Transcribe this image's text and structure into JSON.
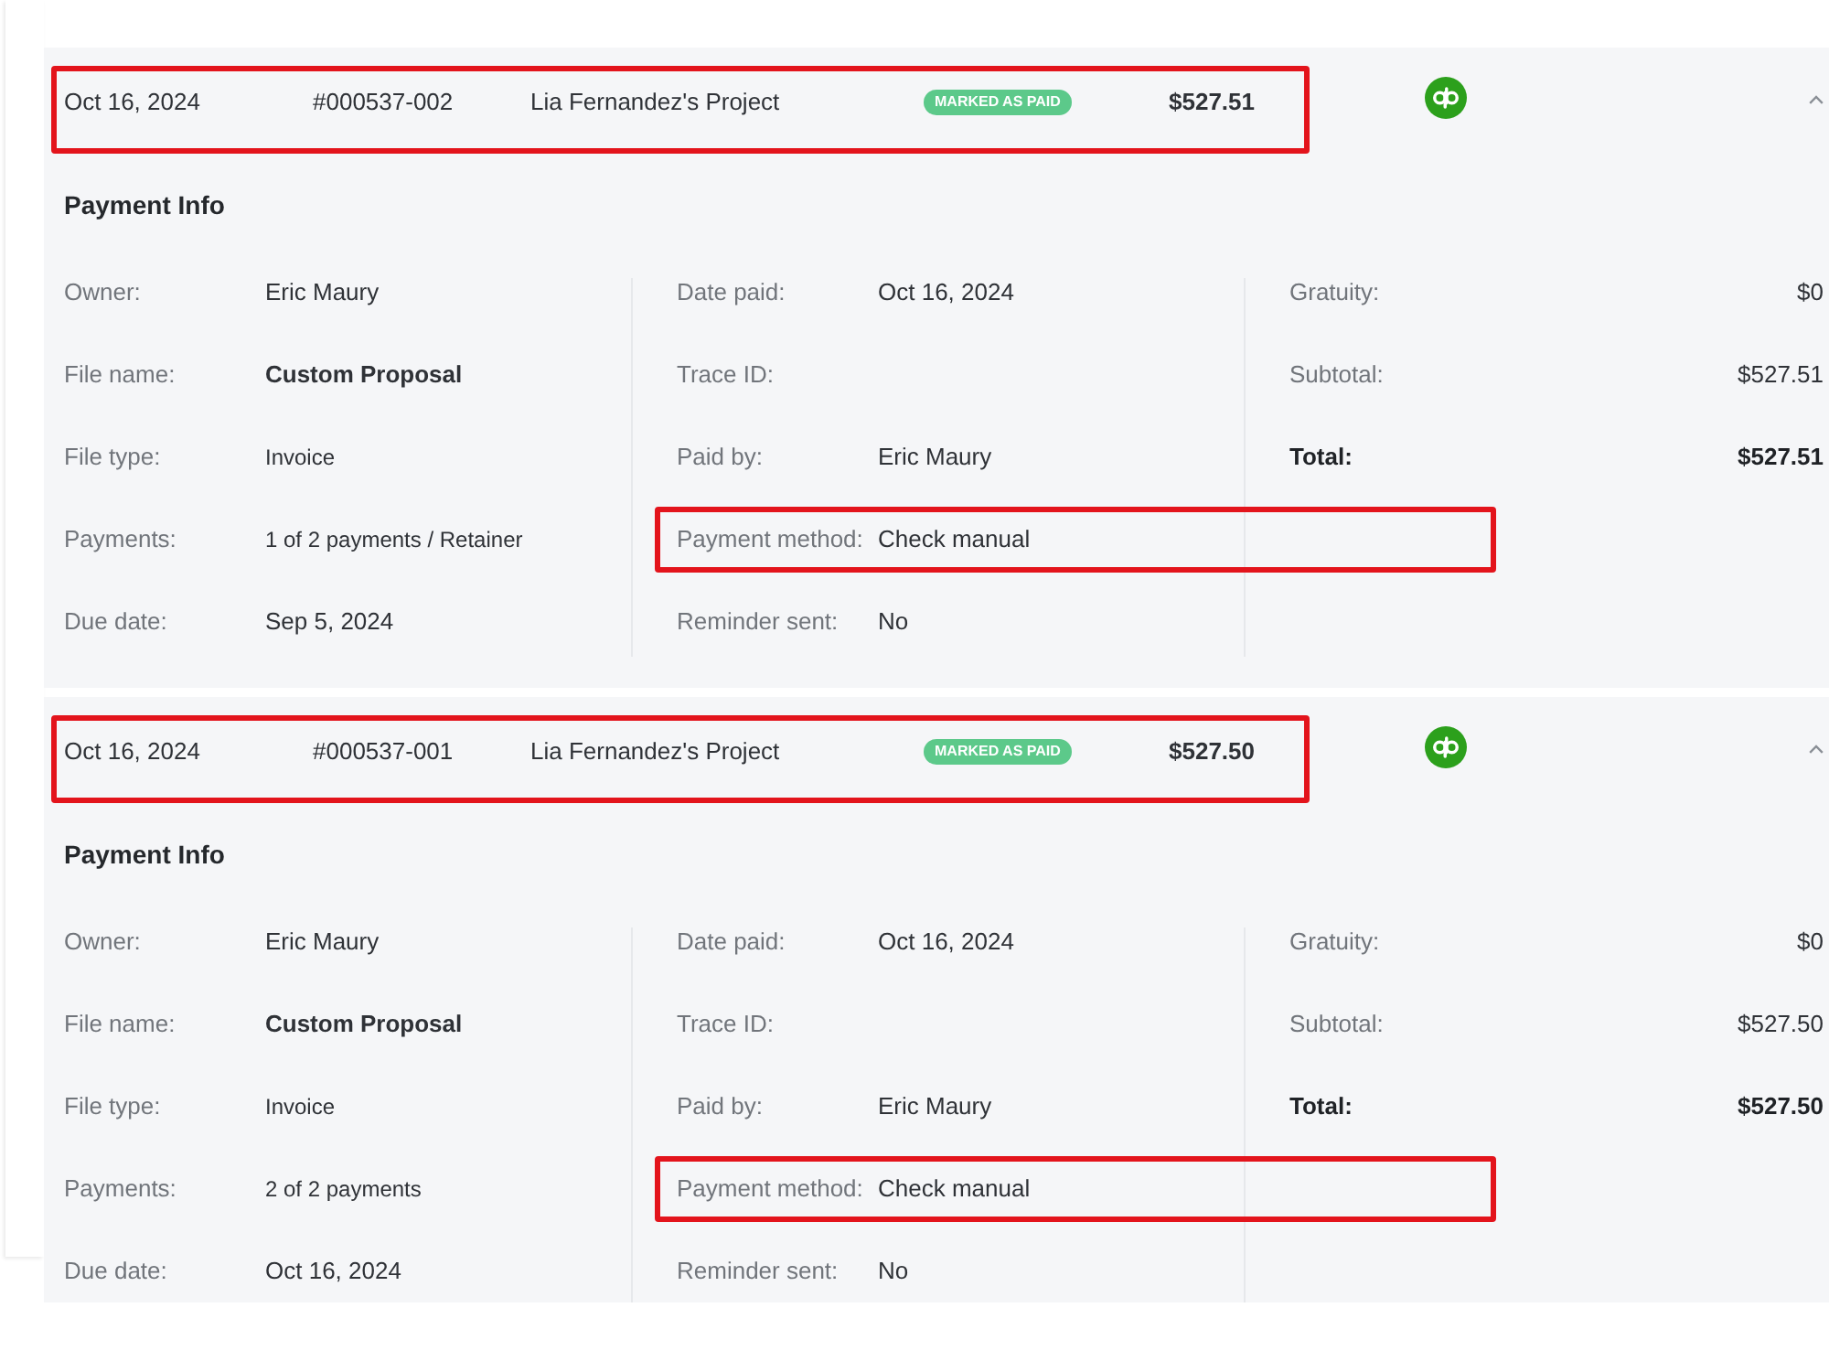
{
  "payments": [
    {
      "expanded": true,
      "header": {
        "highlighted": true,
        "date": "Oct 16, 2024",
        "number": "#000537-002",
        "project": "Lia Fernandez's Project",
        "status": {
          "label": "MARKED AS PAID",
          "kind": "paid"
        },
        "amount": "$527.51",
        "accounting_synced": true
      },
      "section_title": "Payment Info",
      "file_details": [
        {
          "label": "Owner:",
          "value": "Eric Maury",
          "kind": "plain"
        },
        {
          "label": "File name:",
          "value": "Custom Proposal",
          "kind": "bold"
        },
        {
          "label": "File type:",
          "value": "Invoice",
          "kind": "small"
        },
        {
          "label": "Payments:",
          "value": "1 of 2 payments / Retainer",
          "kind": "small"
        },
        {
          "label": "Due date:",
          "value": "Sep 5, 2024",
          "kind": "plain"
        }
      ],
      "payment_details": [
        {
          "label": "Date paid:",
          "value": "Oct 16, 2024",
          "highlighted": false
        },
        {
          "label": "Trace ID:",
          "highlighted": false
        },
        {
          "label": "Paid by:",
          "value": "Eric Maury",
          "highlighted": false
        },
        {
          "label": "Payment method:",
          "value": "Check manual",
          "highlighted": true
        },
        {
          "label": "Reminder sent:",
          "value": "No",
          "highlighted": false
        }
      ],
      "totals": [
        {
          "label": "Gratuity:",
          "value": "$0",
          "kind": "plain"
        },
        {
          "label": "Subtotal:",
          "value": "$527.51",
          "kind": "plain"
        },
        {
          "label": "Total:",
          "value": "$527.51",
          "kind": "total"
        }
      ]
    },
    {
      "expanded": true,
      "header": {
        "highlighted": true,
        "date": "Oct 16, 2024",
        "number": "#000537-001",
        "project": "Lia Fernandez's Project",
        "status": {
          "label": "MARKED AS PAID",
          "kind": "paid"
        },
        "amount": "$527.50",
        "accounting_synced": true
      },
      "section_title": "Payment Info",
      "file_details": [
        {
          "label": "Owner:",
          "value": "Eric Maury",
          "kind": "plain"
        },
        {
          "label": "File name:",
          "value": "Custom Proposal",
          "kind": "bold"
        },
        {
          "label": "File type:",
          "value": "Invoice",
          "kind": "small"
        },
        {
          "label": "Payments:",
          "value": "2 of 2 payments",
          "kind": "small"
        },
        {
          "label": "Due date:",
          "value": "Oct 16, 2024",
          "kind": "plain"
        }
      ],
      "payment_details": [
        {
          "label": "Date paid:",
          "value": "Oct 16, 2024",
          "highlighted": false
        },
        {
          "label": "Trace ID:",
          "highlighted": false
        },
        {
          "label": "Paid by:",
          "value": "Eric Maury",
          "highlighted": false
        },
        {
          "label": "Payment method:",
          "value": "Check manual",
          "highlighted": true
        },
        {
          "label": "Reminder sent:",
          "value": "No",
          "highlighted": false
        }
      ],
      "totals": [
        {
          "label": "Gratuity:",
          "value": "$0",
          "kind": "plain"
        },
        {
          "label": "Subtotal:",
          "value": "$527.50",
          "kind": "plain"
        },
        {
          "label": "Total:",
          "value": "$527.50",
          "kind": "total"
        }
      ]
    }
  ]
}
